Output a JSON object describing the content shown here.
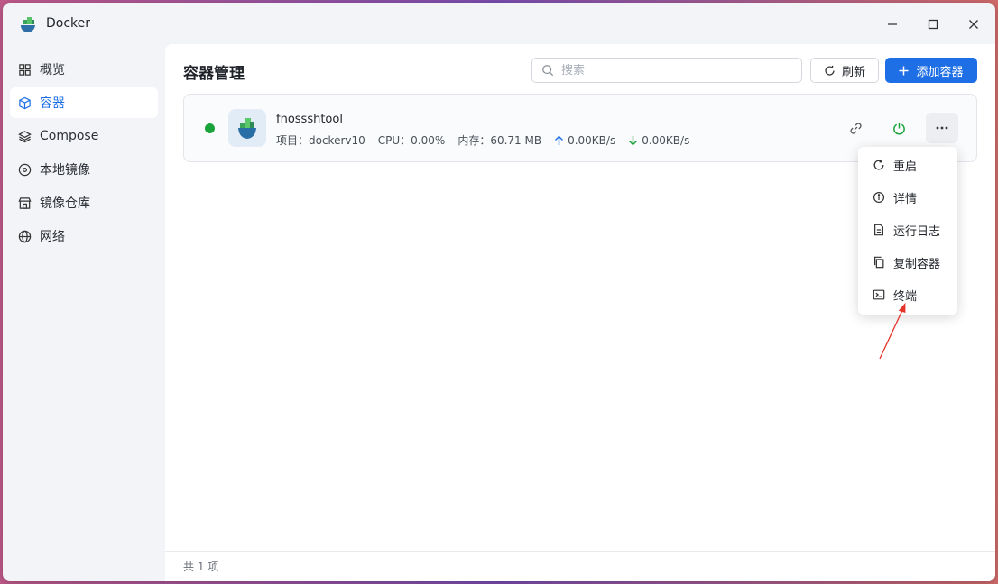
{
  "window": {
    "title": "Docker"
  },
  "sidebar": {
    "items": [
      {
        "label": "概览",
        "icon": "grid-icon"
      },
      {
        "label": "容器",
        "icon": "cube-icon",
        "active": true
      },
      {
        "label": "Compose",
        "icon": "layers-icon"
      },
      {
        "label": "本地镜像",
        "icon": "disc-icon"
      },
      {
        "label": "镜像仓库",
        "icon": "store-icon"
      },
      {
        "label": "网络",
        "icon": "globe-icon"
      }
    ]
  },
  "header": {
    "title": "容器管理",
    "search_placeholder": "搜索",
    "refresh_label": "刷新",
    "add_label": "添加容器"
  },
  "container": {
    "name": "fnossshtool",
    "status": "running",
    "project": "项目：dockerv10",
    "cpu": "CPU：0.00%",
    "memory": "内存：60.71 MB",
    "upload": "0.00KB/s",
    "download": "0.00KB/s"
  },
  "context_menu": {
    "items": [
      {
        "label": "重启",
        "icon": "restart-icon"
      },
      {
        "label": "详情",
        "icon": "info-icon"
      },
      {
        "label": "运行日志",
        "icon": "log-icon"
      },
      {
        "label": "复制容器",
        "icon": "copy-icon"
      },
      {
        "label": "终端",
        "icon": "terminal-icon"
      }
    ]
  },
  "footer": {
    "total": "共 1 项"
  },
  "colors": {
    "accent": "#1e6fe6",
    "running": "#1aa33a",
    "annotation": "#e5332a"
  }
}
